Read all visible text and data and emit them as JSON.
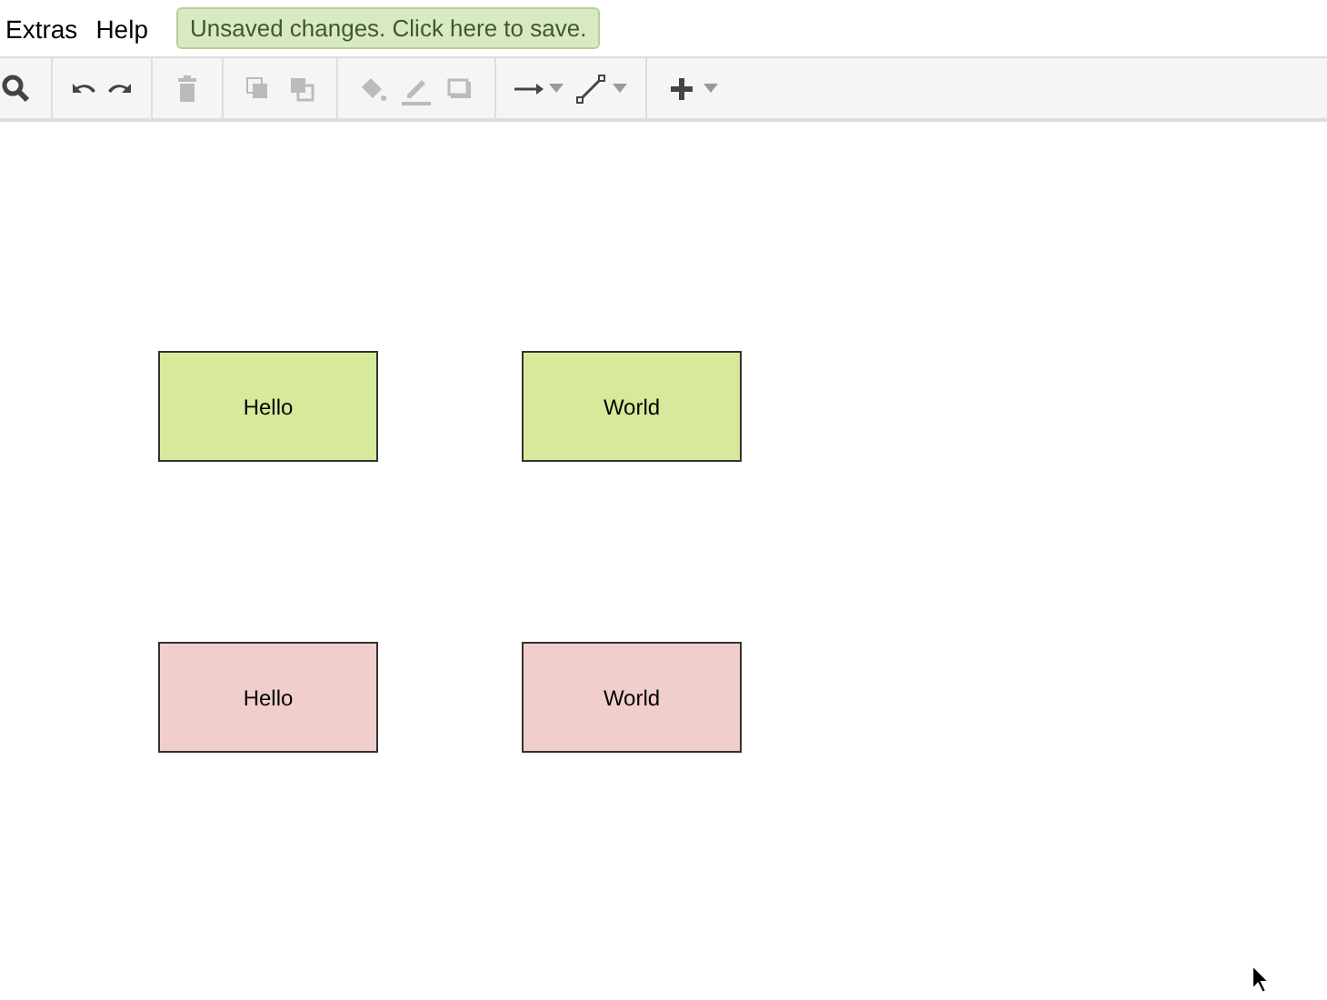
{
  "menu": [
    {
      "label": "Extras"
    },
    {
      "label": "Help"
    }
  ],
  "save_notice": "Unsaved changes. Click here to save.",
  "toolbar": [
    {
      "group": [
        {
          "kind": "zoom",
          "disabled": false
        }
      ]
    },
    {
      "group": [
        {
          "kind": "undo",
          "disabled": false
        },
        {
          "kind": "redo",
          "disabled": false
        }
      ]
    },
    {
      "group": [
        {
          "kind": "delete",
          "disabled": true
        }
      ]
    },
    {
      "group": [
        {
          "kind": "to-front",
          "disabled": true
        },
        {
          "kind": "to-back",
          "disabled": true
        }
      ]
    },
    {
      "group": [
        {
          "kind": "fill",
          "disabled": true
        },
        {
          "kind": "stroke",
          "disabled": true
        },
        {
          "kind": "shadow",
          "disabled": true
        }
      ]
    },
    {
      "group": [
        {
          "kind": "connection",
          "disabled": false
        },
        {
          "kind": "waypoints",
          "disabled": false
        }
      ]
    },
    {
      "group": [
        {
          "kind": "insert",
          "disabled": false
        }
      ]
    }
  ],
  "shapes": [
    {
      "label": "Hello",
      "color": "#d7e99a"
    },
    {
      "label": "World",
      "color": "#d7e99a"
    },
    {
      "label": "Hello",
      "color": "#f0cecb"
    },
    {
      "label": "World",
      "color": "#f0cecb"
    }
  ]
}
